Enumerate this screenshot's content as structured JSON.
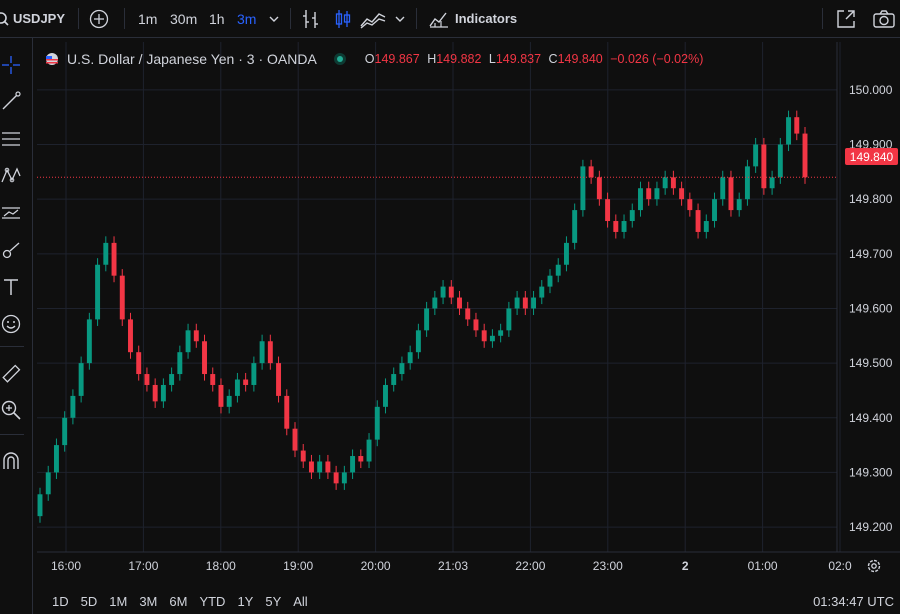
{
  "topbar": {
    "symbol": "USDJPY",
    "intervals": [
      "1m",
      "30m",
      "1h",
      "3m"
    ],
    "active_interval": "3m",
    "indicators_label": "Indicators"
  },
  "legend": {
    "name": "U.S. Dollar / Japanese Yen · 3 · OANDA",
    "o_label": "O",
    "o": "149.867",
    "h_label": "H",
    "h": "149.882",
    "l_label": "L",
    "l": "149.837",
    "c_label": "C",
    "c": "149.840",
    "change": "−0.026 (−0.02%)"
  },
  "current_price": "149.840",
  "colors": {
    "up": "#089981",
    "down": "#f23645",
    "accent": "#2962ff",
    "grid": "#1e222d"
  },
  "chart_data": {
    "type": "candlestick",
    "y_axis_labels": [
      "150.000",
      "149.900",
      "149.800",
      "149.700",
      "149.600",
      "149.500",
      "149.400",
      "149.300",
      "149.200"
    ],
    "ylim": [
      149.18,
      150.04
    ],
    "x_axis_labels": [
      "16:00",
      "17:00",
      "18:00",
      "19:00",
      "20:00",
      "21:03",
      "22:00",
      "23:00",
      "2",
      "01:00",
      "02:0"
    ],
    "series": [
      {
        "name": "close",
        "values": [
          149.26,
          149.3,
          149.35,
          149.4,
          149.44,
          149.5,
          149.58,
          149.68,
          149.72,
          149.66,
          149.58,
          149.52,
          149.48,
          149.46,
          149.43,
          149.46,
          149.48,
          149.52,
          149.56,
          149.54,
          149.48,
          149.46,
          149.42,
          149.44,
          149.47,
          149.46,
          149.5,
          149.54,
          149.5,
          149.44,
          149.38,
          149.34,
          149.32,
          149.3,
          149.32,
          149.3,
          149.28,
          149.3,
          149.33,
          149.32,
          149.36,
          149.42,
          149.46,
          149.48,
          149.5,
          149.52,
          149.56,
          149.6,
          149.62,
          149.64,
          149.62,
          149.6,
          149.58,
          149.56,
          149.54,
          149.55,
          149.56,
          149.6,
          149.62,
          149.6,
          149.62,
          149.64,
          149.66,
          149.68,
          149.72,
          149.78,
          149.86,
          149.84,
          149.8,
          149.76,
          149.74,
          149.76,
          149.78,
          149.82,
          149.8,
          149.82,
          149.84,
          149.82,
          149.8,
          149.78,
          149.74,
          149.76,
          149.8,
          149.84,
          149.78,
          149.8,
          149.86,
          149.9,
          149.82,
          149.84,
          149.9,
          149.95,
          149.92,
          149.84
        ]
      }
    ]
  },
  "bottombar": {
    "ranges": [
      "1D",
      "5D",
      "1M",
      "3M",
      "6M",
      "YTD",
      "1Y",
      "5Y",
      "All"
    ],
    "clock": "01:34:47 UTC"
  }
}
